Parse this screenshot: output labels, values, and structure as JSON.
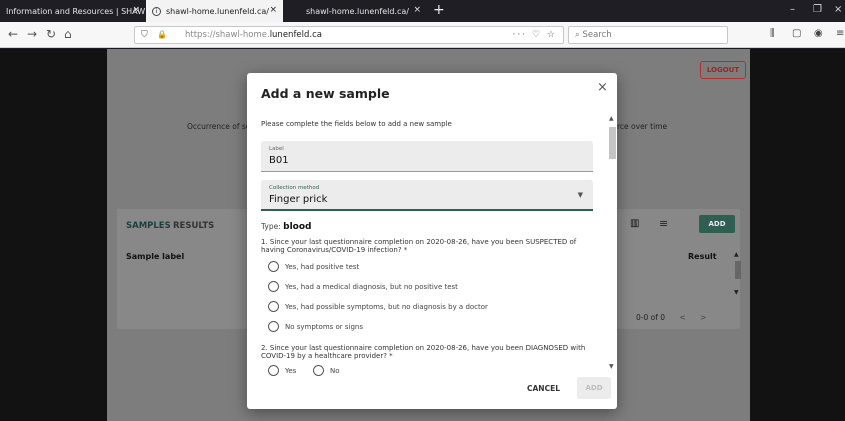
{
  "browser": {
    "tabs": [
      {
        "title": "Information and Resources | SHAW",
        "close": "×"
      },
      {
        "title": "shawl-home.lunenfeld.ca/",
        "close": "×"
      },
      {
        "title": "shawl-home.lunenfeld.ca/",
        "close": "×"
      }
    ],
    "new_tab": "+",
    "window_controls": [
      "–",
      "❐",
      "×"
    ],
    "nav": {
      "back": "←",
      "forward": "→",
      "reload": "↻",
      "home": "⌂"
    },
    "url_prefix": "https://shawl-home.",
    "url_domain": "lunenfeld.ca",
    "url_actions": "··· ♡ ☆",
    "search_placeholder": "Search",
    "toolbar_icons": [
      "⫼",
      "▢",
      "◉",
      "≡"
    ]
  },
  "page": {
    "logout": "LOGOUT",
    "bg_left_text": "Occurrence of se",
    "bg_right_text": "rce over time",
    "samples_card": {
      "tabs": [
        "SAMPLES",
        "RESULTS"
      ],
      "columns": [
        "Sample label",
        "Result"
      ],
      "add_button": "ADD",
      "pagination": "0-0 of 0",
      "prev": "<",
      "next": ">"
    }
  },
  "dialog": {
    "title": "Add a new sample",
    "close": "×",
    "intro": "Please complete the fields below to add a new sample",
    "label_field": {
      "label": "Label",
      "value": "B01"
    },
    "method_field": {
      "label": "Collection method",
      "value": "Finger prick"
    },
    "type_prefix": "Type:",
    "type_value": "blood",
    "question1": "1. Since your last questionnaire completion on 2020-08-26, have you been SUSPECTED of having Coronavirus/COVID-19 infection? *",
    "question1_options": [
      "Yes, had positive test",
      "Yes, had a medical diagnosis, but no positive test",
      "Yes, had possible symptoms, but no diagnosis by a doctor",
      "No symptoms or signs"
    ],
    "question2": "2. Since your last questionnaire completion on 2020-08-26, have you been DIAGNOSED with COVID-19 by a healthcare provider? *",
    "question2_options": [
      "Yes",
      "No"
    ],
    "cancel": "CANCEL",
    "add": "ADD"
  },
  "colors": {
    "accent": "#2f5f52",
    "logout": "#a12222",
    "disabled": "#bdbdbd"
  }
}
